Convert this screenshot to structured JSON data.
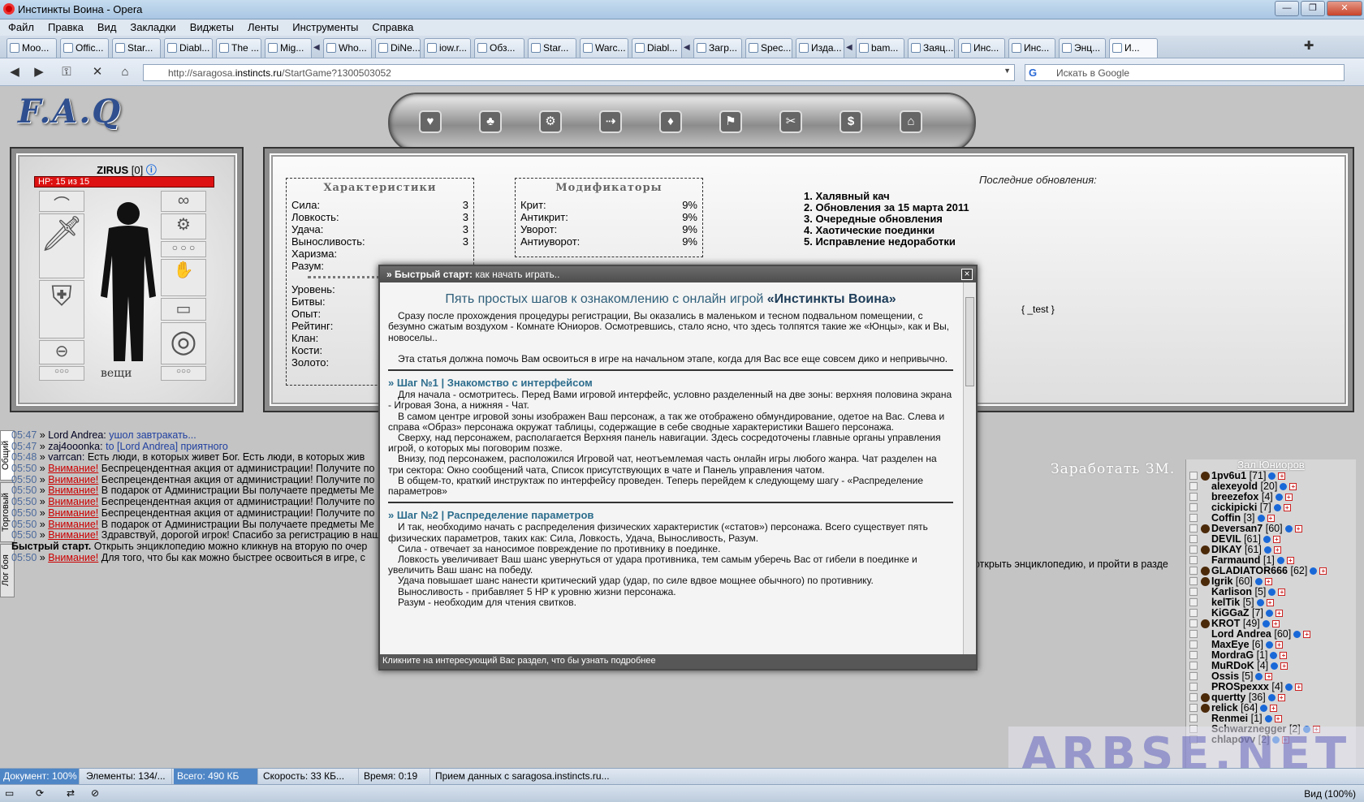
{
  "window": {
    "title": "Инстинкты Воина - Opera",
    "buttons": [
      "—",
      "❐",
      "✕"
    ]
  },
  "menu": [
    "Файл",
    "Правка",
    "Вид",
    "Закладки",
    "Виджеты",
    "Ленты",
    "Инструменты",
    "Справка"
  ],
  "tabs": [
    "Moo...",
    "Offic...",
    "Star...",
    "Diabl...",
    "The ...",
    "Mig...",
    "Who...",
    "DiNe...",
    "iow.r...",
    "Обз...",
    "Star...",
    "Warc...",
    "Diabl...",
    "Загр...",
    "Spec...",
    "Изда...",
    "bam...",
    "Заяц...",
    "Инс...",
    "Инс...",
    "Энц...",
    "И..."
  ],
  "address": {
    "prefix": "http://saragosa.",
    "domain": "instincts.ru",
    "path": "/StartGame?1300503052",
    "search_placeholder": "Искать в Google"
  },
  "game": {
    "logo": "F.A.Q",
    "nav_icons": [
      "♥",
      "♣",
      "⚙",
      "⇢",
      "♦",
      "⚑",
      "✂",
      "$",
      "⌂"
    ],
    "char_name": "ZIRUS",
    "char_level": "[0]",
    "hp": "HP: 15 из 15",
    "inventory_label": "вещи",
    "stats_title": "Характеристики",
    "stats": [
      [
        "Сила:",
        "3"
      ],
      [
        "Ловкость:",
        "3"
      ],
      [
        "Удача:",
        "3"
      ],
      [
        "Выносливость:",
        "3"
      ],
      [
        "Харизма:",
        ""
      ],
      [
        "Разум:",
        ""
      ]
    ],
    "mods_title": "Модификаторы",
    "mods": [
      [
        "Крит:",
        "9%"
      ],
      [
        "Антикрит:",
        "9%"
      ],
      [
        "Уворот:",
        "9%"
      ],
      [
        "Антиуворот:",
        "9%"
      ]
    ],
    "info": [
      "Уровень:",
      "Битвы:",
      "Опыт:",
      "Рейтинг:",
      "Клан:",
      "Кости:",
      "Золото:"
    ],
    "updates_title": "Последние обновления:",
    "updates": [
      "1. Халявный кач",
      "2. Обновления за 15 марта 2011",
      "3. Очередные обновления",
      "4. Хаотические поединки",
      "5. Исправление недоработки"
    ],
    "test": "{ _test }",
    "earn": "Заработать ЗМ.",
    "side_tabs": [
      "Общий",
      "Торговый",
      "Лог боя"
    ]
  },
  "chat": [
    {
      "t": "05:47",
      "who": "Lord Andrea:",
      "msg": "ушол завтракать..."
    },
    {
      "t": "05:47",
      "who": "zaj4ooonka:",
      "msg": "to [Lord Andrea] приятного"
    },
    {
      "t": "05:48",
      "who": "varrcan:",
      "msg": "Есть люди, в которых живет Бог. Есть люди, в которых жив"
    },
    {
      "t": "05:50",
      "warn": "Внимание!",
      "msg": "Беспрецендентная акция от администрации! Получите по"
    },
    {
      "t": "05:50",
      "warn": "Внимание!",
      "msg": "Беспрецендентная акция от администрации! Получите по"
    },
    {
      "t": "05:50",
      "warn": "Внимание!",
      "msg": "В подарок от Администрации Вы получаете предметы Ме"
    },
    {
      "t": "05:50",
      "warn": "Внимание!",
      "msg": "Беспрецендентная акция от администрации! Получите по"
    },
    {
      "t": "05:50",
      "warn": "Внимание!",
      "msg": "Беспрецендентная акция от администрации! Получите по"
    },
    {
      "t": "05:50",
      "warn": "Внимание!",
      "msg": "В подарок от Администрации Вы получаете предметы Ме"
    },
    {
      "t": "05:50",
      "warn": "Внимание!",
      "msg": "Здравствуй, дорогой игрок! Спасибо за регистрацию в наш"
    },
    {
      "t": "",
      "bold": "Быстрый старт.",
      "msg": "Открыть энциклопедию можно кликнув на вторую по очер"
    },
    {
      "t": "05:50",
      "warn": "Внимание!",
      "msg": "Для того, что бы как можно быстрее освоиться в игре, с"
    }
  ],
  "chat_tail": "открыть энциклопедию, и пройти в разде",
  "chat_tail_bold": "энциклопедию",
  "users": {
    "hall": "Зал Юниоров",
    "list": [
      [
        "1pv6u1",
        "[71]"
      ],
      [
        "alexeyold",
        "[20]"
      ],
      [
        "breezefox",
        "[4]"
      ],
      [
        "cickipicki",
        "[7]"
      ],
      [
        "Coffin",
        "[3]"
      ],
      [
        "Deversan7",
        "[60]"
      ],
      [
        "DEVIL",
        "[61]"
      ],
      [
        "DIKAY",
        "[61]"
      ],
      [
        "Farmaund",
        "[1]"
      ],
      [
        "GLADIATOR666",
        "[62]"
      ],
      [
        "Igrik",
        "[60]"
      ],
      [
        "Karlison",
        "[5]"
      ],
      [
        "kelTik",
        "[5]"
      ],
      [
        "KiGGaZ",
        "[7]"
      ],
      [
        "KROT",
        "[49]"
      ],
      [
        "Lord Andrea",
        "[60]"
      ],
      [
        "MaxEye",
        "[6]"
      ],
      [
        "MordraG",
        "[1]"
      ],
      [
        "MuRDoK",
        "[4]"
      ],
      [
        "Ossis",
        "[5]"
      ],
      [
        "PROSpexxx",
        "[4]"
      ],
      [
        "quertty",
        "[36]"
      ],
      [
        "relick",
        "[64]"
      ],
      [
        "Renmei",
        "[1]"
      ],
      [
        "Schwarznegger",
        "[2]"
      ],
      [
        "chlapovv",
        "[2]"
      ]
    ]
  },
  "modal": {
    "head_bold": "» Быстрый старт:",
    "head": "как начать играть..",
    "title_pre": "Пять простых шагов к ознакомлению с онлайн игрой",
    "title_bold": "«Инстинкты Воина»",
    "p1": "Сразу после прохождения процедуры регистрации, Вы оказались в маленьком и тесном подвальном помещении, с безумно сжатым воздухом - Комнате Юниоров. Осмотревшись, стало ясно, что здесь толпятся такие же «Юнцы», как и Вы, новоселы..",
    "p2": "Эта статья должна помочь Вам освоиться в игре на начальном этапе, когда для Вас все еще совсем дико и непривычно.",
    "step1": "» Шаг №1 | Знакомство с интерфейсом",
    "s1": [
      "Для начала - осмотритесь. Перед Вами игровой интерфейс, условно разделенный на две зоны: верхняя половина экрана - Игровая Зона, а нижняя - Чат.",
      "В самом центре игровой зоны изображен Ваш персонаж, а так же отображено обмундирование, одетое на Вас. Слева и справа «Образ» персонажа окружат таблицы, содержащие в себе сводные характеристики Вашего персонажа.",
      "Сверху, над персонажем, располагается Верхняя панель навигации. Здесь сосредоточены главные органы управления игрой, о которых мы поговорим позже.",
      "Внизу, под персонажем, расположился Игровой чат, неотъемлемая часть онлайн игры любого жанра. Чат разделен на три сектора: Окно сообщений чата, Список присутствующих в чате и Панель управления чатом.",
      "В общем-то, краткий инструктаж по интерфейсу проведен. Теперь перейдем к следующему шагу - «Распределение параметров»"
    ],
    "step2": "» Шаг №2 | Распределение параметров",
    "s2": [
      "И так, необходимо начать с распределения физических характеристик («статов») персонажа. Всего существует пять физических параметров, таких как: Сила, Ловкость, Удача, Выносливость, Разум.",
      "Сила - отвечает за наносимое повреждение по противнику в поединке.",
      "Ловкость увеличивает Ваш шанс увернуться от удара противника, тем самым уберечь Вас от гибели в поединке и увеличить Ваш шанс на победу.",
      "Удача повышает шанс нанести критический удар (удар, по силе вдвое мощнее обычного) по противнику.",
      "Выносливость - прибавляет 5 HP к уровню жизни персонажа.",
      "Разум - необходим для чтения свитков."
    ],
    "footer": "Кликните на интересующий Вас раздел, что бы узнать подробнее"
  },
  "status": {
    "doc": "Документ:",
    "doc_pct": "100%",
    "elements": "Элементы:",
    "elements_val": "134/...",
    "total": "Всего:",
    "total_val": "490 КБ",
    "speed": "Скорость:",
    "speed_val": "33 КБ...",
    "time": "Время:",
    "time_val": "0:19",
    "msg": "Прием данных с saragosa.instincts.ru..."
  },
  "zoom": "Вид (100%)",
  "watermark": "ARBSE.NET"
}
